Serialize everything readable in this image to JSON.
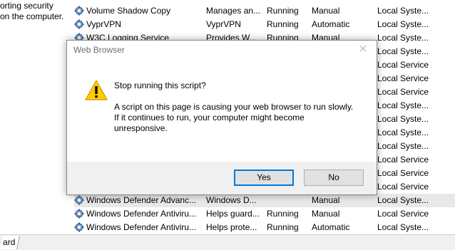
{
  "background": {
    "left_desc": {
      "line1": "orting security",
      "line2": "on the computer."
    },
    "services": [
      {
        "name": "Volume Shadow Copy",
        "description": "Manages an...",
        "status": "Running",
        "startup": "Manual",
        "logon": "Local Syste..."
      },
      {
        "name": "VyprVPN",
        "description": "VyprVPN",
        "status": "Running",
        "startup": "Automatic",
        "logon": "Local Syste..."
      },
      {
        "name": "W3C Logging Service",
        "description": "Provides W...",
        "status": "Running",
        "startup": "Manual",
        "logon": "Local Syste..."
      },
      {
        "name": "",
        "description": "",
        "status": "",
        "startup": "",
        "logon": "Local Syste..."
      },
      {
        "name": "",
        "description": "",
        "status": "",
        "startup": "",
        "logon": "Local Service"
      },
      {
        "name": "",
        "description": "",
        "status": "",
        "startup": "",
        "logon": "Local Service"
      },
      {
        "name": "",
        "description": "",
        "status": "",
        "startup": "",
        "logon": "Local Service"
      },
      {
        "name": "",
        "description": "",
        "status": "",
        "startup": "",
        "logon": "Local Syste..."
      },
      {
        "name": "",
        "description": "",
        "status": "",
        "startup": "",
        "logon": "Local Syste..."
      },
      {
        "name": "",
        "description": "",
        "status": "",
        "startup": "",
        "logon": "Local Syste..."
      },
      {
        "name": "",
        "description": "",
        "status": "",
        "startup": "",
        "logon": "Local Syste..."
      },
      {
        "name": "",
        "description": "",
        "status": "",
        "startup": "",
        "logon": "Local Service"
      },
      {
        "name": "",
        "description": "",
        "status": "",
        "startup": "",
        "logon": "Local Service"
      },
      {
        "name": "",
        "description": "",
        "status": "",
        "startup": "",
        "logon": "Local Service"
      },
      {
        "name": "Windows Defender Advanc...",
        "description": "Windows D...",
        "status": "",
        "startup": "Manual",
        "logon": "Local Syste..."
      },
      {
        "name": "Windows Defender Antiviru...",
        "description": "Helps guard...",
        "status": "Running",
        "startup": "Manual",
        "logon": "Local Service"
      },
      {
        "name": "Windows Defender Antiviru...",
        "description": "Helps prote...",
        "status": "Running",
        "startup": "Automatic",
        "logon": "Local Syste..."
      }
    ],
    "tab_label": "ard"
  },
  "dialog": {
    "title": "Web Browser",
    "close_glyph": "✕",
    "heading": "Stop running this script?",
    "body_line1": "A script on this page is causing your web browser to run slowly.",
    "body_line2": "If it continues to run, your computer might become",
    "body_line3": "unresponsive.",
    "yes_label": "Yes",
    "no_label": "No",
    "warning_icon": "warning-triangle-icon"
  },
  "colors": {
    "warning_fill": "#ffcc00",
    "accent_focus": "#0078d7",
    "footer_bg": "#f0f0f0"
  }
}
